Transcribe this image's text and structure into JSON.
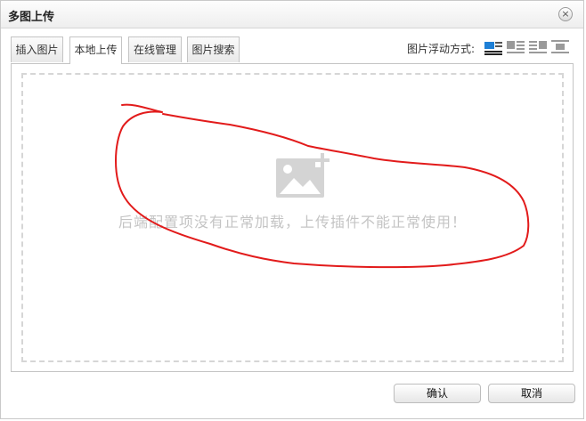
{
  "dialog": {
    "title": "多图上传",
    "close_glyph": "×"
  },
  "tabs": [
    {
      "label": "插入图片",
      "active": false
    },
    {
      "label": "本地上传",
      "active": true
    },
    {
      "label": "在线管理",
      "active": false
    },
    {
      "label": "图片搜索",
      "active": false
    }
  ],
  "float_mode": {
    "label": "图片浮动方式:",
    "options": [
      "align-none-icon",
      "align-left-icon",
      "align-right-icon",
      "align-center-icon"
    ],
    "selected": "align-none-icon"
  },
  "upload_area": {
    "icon": "image-add-icon",
    "message": "后端配置项没有正常加载，上传插件不能正常使用！"
  },
  "buttons": {
    "confirm": "确认",
    "cancel": "取消"
  },
  "annotation": {
    "stroke_color": "#e21b1b"
  }
}
